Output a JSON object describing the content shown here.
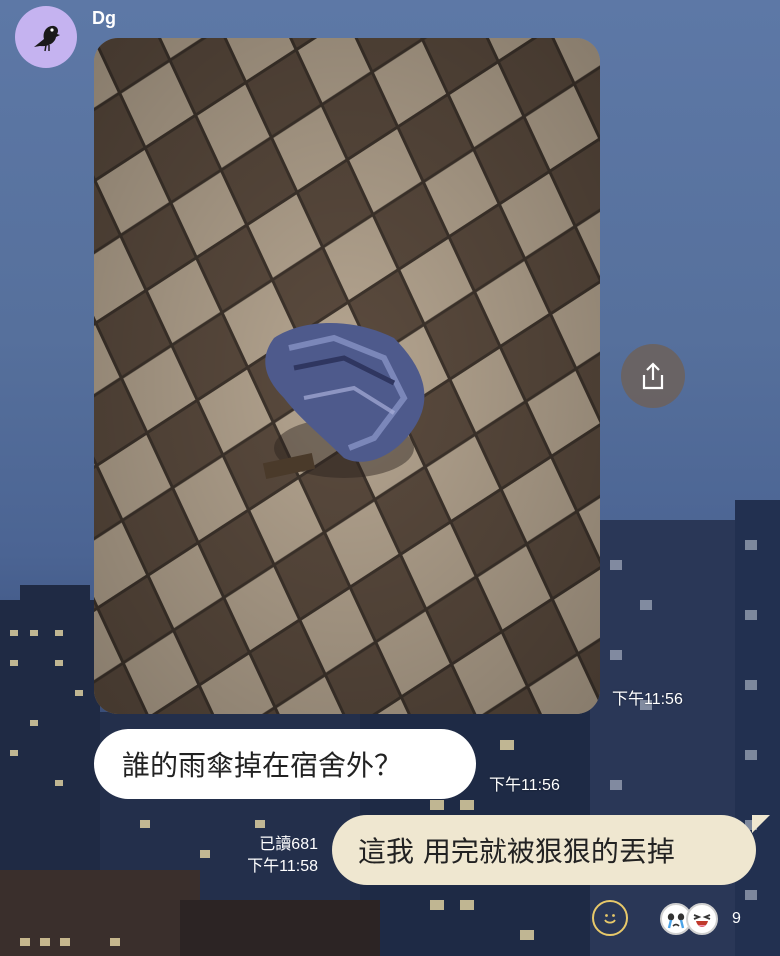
{
  "chat": {
    "sender_name": "Dg",
    "avatar_icon": "bird-icon",
    "avatar_color": "#c5b3f0"
  },
  "messages": [
    {
      "type": "image",
      "direction": "incoming",
      "image_desc_icon": "photo-of-umbrella-on-tiled-ground",
      "time": "下午11:56"
    },
    {
      "type": "text",
      "direction": "incoming",
      "text": "誰的雨傘掉在宿舍外？",
      "time": "下午11:56"
    },
    {
      "type": "text",
      "direction": "outgoing",
      "text": "這我 用完就被狠狠的丟掉",
      "read_status": "已讀681",
      "time": "下午11:58"
    }
  ],
  "actions": {
    "share_icon": "share-icon",
    "emoji_icon": "smiley-icon"
  },
  "reactions": {
    "icons": [
      "crying-face-icon",
      "laughing-face-icon"
    ],
    "count": "9"
  },
  "colors": {
    "incoming_bubble": "#ffffff",
    "outgoing_bubble": "#efe7d0"
  }
}
